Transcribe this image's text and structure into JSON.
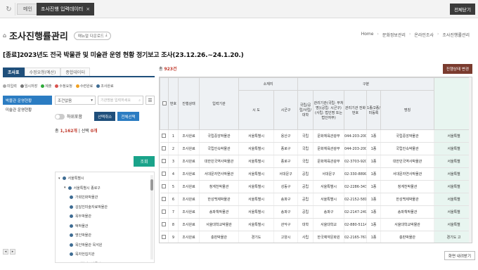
{
  "topbar": {
    "main_tab": "메인",
    "active_tab": "조사진행 입력데이터",
    "close_tab_icon": "×",
    "close_all": "전체닫기"
  },
  "header": {
    "title": "조사진행률관리",
    "manual_button": "매뉴얼 다운로드",
    "breadcrumb": [
      "Home",
      "문화정보관리",
      "온라인조사",
      "조사진행률관리"
    ]
  },
  "survey_title": "[종료]2023년도 전국 박물관 및 미술관 운영 현황 정기보고 조사(23.12.26.~24.1.20.)",
  "left": {
    "tabs": [
      "조사표",
      "수정요청(예산)",
      "종합데이터"
    ],
    "legend": [
      {
        "label": "미입력",
        "color": "#aaaaaa"
      },
      {
        "label": "임시저장",
        "color": "#777777"
      },
      {
        "label": "제출",
        "color": "#2eaa3a"
      },
      {
        "label": "수정요청",
        "color": "#d9534f"
      },
      {
        "label": "수련완료",
        "color": "#f0a020"
      },
      {
        "label": "조사완료",
        "color": "#3e6c93"
      }
    ],
    "menu": [
      "박물관 운영현황",
      "미술관 운영현황"
    ],
    "select_value": "조건없음",
    "search_placeholder": "기관명을 입력하세요",
    "toggle_label": "하위포함",
    "btn_cancel": "선택취소",
    "btn_all": "전체선택",
    "count_prefix": "총 ",
    "count_total": "1,162개",
    "count_mid": " | 선택 ",
    "count_selected": "0개",
    "btn_search": "조회",
    "tree": [
      {
        "label": "서울특별시",
        "level": 0,
        "arrow": "▾"
      },
      {
        "label": "서울특별시 종로구",
        "level": 1,
        "arrow": "▾"
      },
      {
        "label": "가회민화박물관",
        "level": 2
      },
      {
        "label": "김달진미술자료박물관",
        "level": 2
      },
      {
        "label": "옥두박물관",
        "level": 2
      },
      {
        "label": "떡박물관",
        "level": 2
      },
      {
        "label": "명인박물관",
        "level": 2
      },
      {
        "label": "목인박물관 목석원",
        "level": 2
      },
      {
        "label": "묵자헌집지관",
        "level": 2
      },
      {
        "label": "부너향선구박물관",
        "level": 2
      }
    ]
  },
  "right": {
    "total_prefix": "총 ",
    "total_count": "923건",
    "status_button": "진행상태 변경",
    "headers": {
      "no": "번호",
      "status": "진행상태",
      "org": "입력기관",
      "location": "소재지",
      "sido": "시 도",
      "sigungu": "시군구",
      "section": "구분",
      "national": "국립/공립/사립/대학",
      "agency": "관리기관(국립: 부처명)(공립: 시군구)(사립: 법인명 또는 법인여부)",
      "phone": "관리기관 전화번호",
      "type": "1종/2종/미등록",
      "name": "명칭",
      "extra": ""
    },
    "rows": [
      [
        "1",
        "조사완료",
        "국립중앙박물관",
        "서울특별시",
        "용산구",
        "국립",
        "문화체육관광부",
        "044-203-2000",
        "1종",
        "국립중앙박물관",
        "서울특별"
      ],
      [
        "2",
        "조사완료",
        "국립민속박물관",
        "서울특별시",
        "종로구",
        "국립",
        "문화체육관광부",
        "044-203-2000",
        "1종",
        "국립민속박물관",
        "서울특별"
      ],
      [
        "3",
        "조사완료",
        "대한민국역사박물관",
        "서울특별시",
        "종로구",
        "국립",
        "문화체육관광부",
        "02-3703-9200",
        "1종",
        "대한민국역사박물관",
        "서울특별"
      ],
      [
        "4",
        "조사완료",
        "서대문자연사박물관",
        "서울특별시",
        "서대문구",
        "공립",
        "서대문구",
        "02-330-8899",
        "1종",
        "서대문자연사박물관",
        "서울특별"
      ],
      [
        "5",
        "조사완료",
        "청계천박물관",
        "서울특별시",
        "성동구",
        "공립",
        "서울특별시",
        "02-2286-3430",
        "1종",
        "청계천박물관",
        "서울특별"
      ],
      [
        "6",
        "조사완료",
        "한성백제박물관",
        "서울특별시",
        "송파구",
        "공립",
        "서울특별시",
        "02-2152-5812",
        "1종",
        "한성백제박물관",
        "서울특별"
      ],
      [
        "7",
        "조사완료",
        "송파책박물관",
        "서울특별시",
        "송파구",
        "공립",
        "송파구",
        "02-2147-2490",
        "1종",
        "송파책박물관",
        "서울특별"
      ],
      [
        "8",
        "조사완료",
        "서울대학교박물관",
        "서울특별시",
        "관악구",
        "대학",
        "서울대학교",
        "02-880-5114",
        "1종",
        "서울대학교박물관",
        "서울특별"
      ],
      [
        "9",
        "조사완료",
        "충판박물관",
        "경기도",
        "고양시",
        "사립",
        "한국예약문화원",
        "02-2165-7677",
        "1종",
        "충판박물관",
        "경기도 고"
      ]
    ]
  },
  "footer": {
    "prev": "◂",
    "next": "▸",
    "screen_button": "화면 내려받기"
  },
  "icons": {
    "refresh": "refresh-icon",
    "home": "home-icon",
    "search": "search-icon",
    "filter": "filter-icon",
    "download": "download-icon"
  }
}
